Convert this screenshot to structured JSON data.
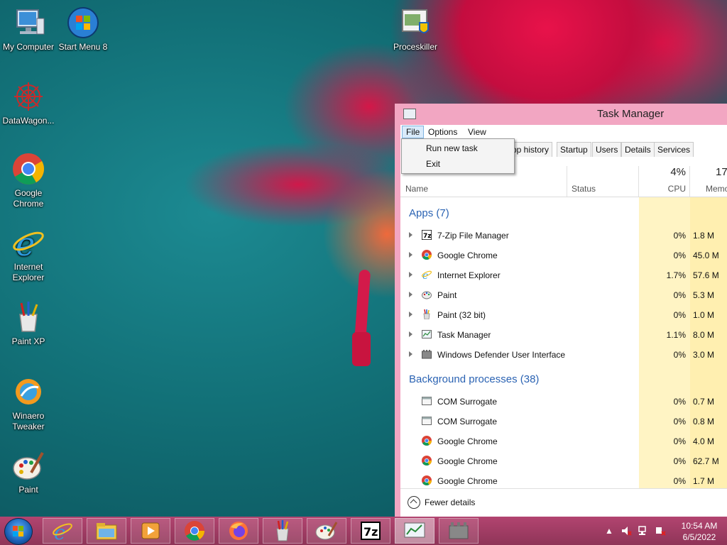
{
  "desktop": {
    "icons": [
      {
        "label": "My Computer"
      },
      {
        "label": "Start Menu 8"
      },
      {
        "label": "Proceskiller"
      },
      {
        "label": "DataWagon..."
      },
      {
        "label": "Google Chrome"
      },
      {
        "label": "Internet Explorer"
      },
      {
        "label": "Paint XP"
      },
      {
        "label": "Winaero Tweaker"
      },
      {
        "label": "Paint"
      }
    ]
  },
  "task_manager": {
    "title": "Task Manager",
    "menu": [
      "File",
      "Options",
      "View"
    ],
    "file_menu_items": [
      "Run new task",
      "Exit"
    ],
    "tabs": [
      "pp history",
      "Startup",
      "Users",
      "Details",
      "Services"
    ],
    "columns": {
      "name": "Name",
      "status": "Status",
      "cpu_total": "4%",
      "cpu": "CPU",
      "mem_total": "17",
      "mem": "Memo"
    },
    "apps_header": "Apps (7)",
    "apps": [
      {
        "name": "7-Zip File Manager",
        "cpu": "0%",
        "mem": "1.8 M"
      },
      {
        "name": "Google Chrome",
        "cpu": "0%",
        "mem": "45.0 M"
      },
      {
        "name": "Internet Explorer",
        "cpu": "1.7%",
        "mem": "57.6 M"
      },
      {
        "name": "Paint",
        "cpu": "0%",
        "mem": "5.3 M"
      },
      {
        "name": "Paint (32 bit)",
        "cpu": "0%",
        "mem": "1.0 M"
      },
      {
        "name": "Task Manager",
        "cpu": "1.1%",
        "mem": "8.0 M"
      },
      {
        "name": "Windows Defender User Interface",
        "cpu": "0%",
        "mem": "3.0 M"
      }
    ],
    "bg_header": "Background processes (38)",
    "background": [
      {
        "name": "COM Surrogate",
        "cpu": "0%",
        "mem": "0.7 M"
      },
      {
        "name": "COM Surrogate",
        "cpu": "0%",
        "mem": "0.8 M"
      },
      {
        "name": "Google Chrome",
        "cpu": "0%",
        "mem": "4.0 M"
      },
      {
        "name": "Google Chrome",
        "cpu": "0%",
        "mem": "62.7 M"
      },
      {
        "name": "Google Chrome",
        "cpu": "0%",
        "mem": "1.7 M"
      }
    ],
    "fewer_details": "Fewer details"
  },
  "taskbar": {
    "apps": [
      "Internet Explorer",
      "File Explorer",
      "Media Player",
      "Google Chrome",
      "Firefox",
      "Paint XP",
      "Paint",
      "7-Zip",
      "Task Manager",
      "Windows Defender"
    ],
    "clock_time": "10:54 AM",
    "clock_date": "6/5/2022"
  },
  "colors": {
    "accent_pink": "#f2a6c2",
    "section_blue": "#2b63b3",
    "cpu_highlight": "#fff4c4"
  }
}
